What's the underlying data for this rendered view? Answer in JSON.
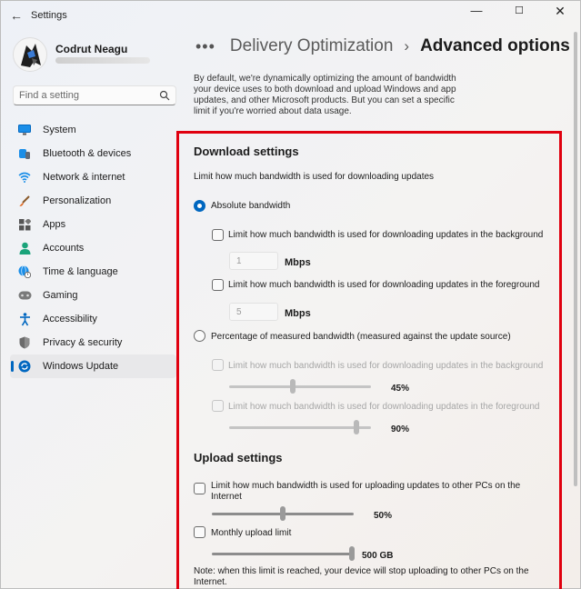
{
  "window": {
    "title": "Settings",
    "minimize": "—",
    "maximize": "☐",
    "close": "✕",
    "back": "←"
  },
  "user": {
    "name": "Codrut Neagu"
  },
  "search": {
    "placeholder": "Find a setting"
  },
  "sidebar": {
    "items": [
      {
        "label": "System",
        "icon": "monitor-icon",
        "color": "#0078d4"
      },
      {
        "label": "Bluetooth & devices",
        "icon": "bluetooth-icon",
        "color": "#0078d4"
      },
      {
        "label": "Network & internet",
        "icon": "wifi-icon",
        "color": "#0078d4"
      },
      {
        "label": "Personalization",
        "icon": "brush-icon",
        "color": "#e0641b"
      },
      {
        "label": "Apps",
        "icon": "apps-icon",
        "color": "#555555"
      },
      {
        "label": "Accounts",
        "icon": "person-icon",
        "color": "#1aa37a"
      },
      {
        "label": "Time & language",
        "icon": "globe-clock-icon",
        "color": "#0078d4"
      },
      {
        "label": "Gaming",
        "icon": "gamepad-icon",
        "color": "#7a7a7a"
      },
      {
        "label": "Accessibility",
        "icon": "accessibility-icon",
        "color": "#0067c0"
      },
      {
        "label": "Privacy & security",
        "icon": "shield-icon",
        "color": "#6b6b6b"
      },
      {
        "label": "Windows Update",
        "icon": "update-icon",
        "color": "#0067c0",
        "active": true
      }
    ]
  },
  "breadcrumb": {
    "overflow": "•••",
    "parent": "Delivery Optimization",
    "separator": "›",
    "current": "Advanced options"
  },
  "intro": "By default, we're dynamically optimizing the amount of bandwidth your device uses to both download and upload Windows and app updates, and other Microsoft products. But you can set a specific limit if you're worried about data usage.",
  "download": {
    "heading": "Download settings",
    "description": "Limit how much bandwidth is used for downloading updates",
    "absolute": {
      "label": "Absolute bandwidth",
      "selected": true,
      "background": {
        "label": "Limit how much bandwidth is used for downloading updates in the background",
        "value": "1",
        "unit": "Mbps",
        "checked": false
      },
      "foreground": {
        "label": "Limit how much bandwidth is used for downloading updates in the foreground",
        "value": "5",
        "unit": "Mbps",
        "checked": false
      }
    },
    "percentage": {
      "label": "Percentage of measured bandwidth (measured against the update source)",
      "selected": false,
      "background": {
        "label": "Limit how much bandwidth is used for downloading updates in the background",
        "value_text": "45%",
        "value": 0.45
      },
      "foreground": {
        "label": "Limit how much bandwidth is used for downloading updates in the foreground",
        "value_text": "90%",
        "value": 0.9
      }
    }
  },
  "upload": {
    "heading": "Upload settings",
    "limit": {
      "label_line1": "Limit how much bandwidth is used for uploading updates to other PCs on the",
      "label_line2": "Internet",
      "value_text": "50%",
      "value": 0.5
    },
    "monthly": {
      "label": "Monthly upload limit",
      "value_text": "500 GB",
      "value": 1.0
    },
    "note_line1": "Note: when this limit is reached, your device will stop uploading to other PCs on the",
    "note_line2": "Internet."
  }
}
